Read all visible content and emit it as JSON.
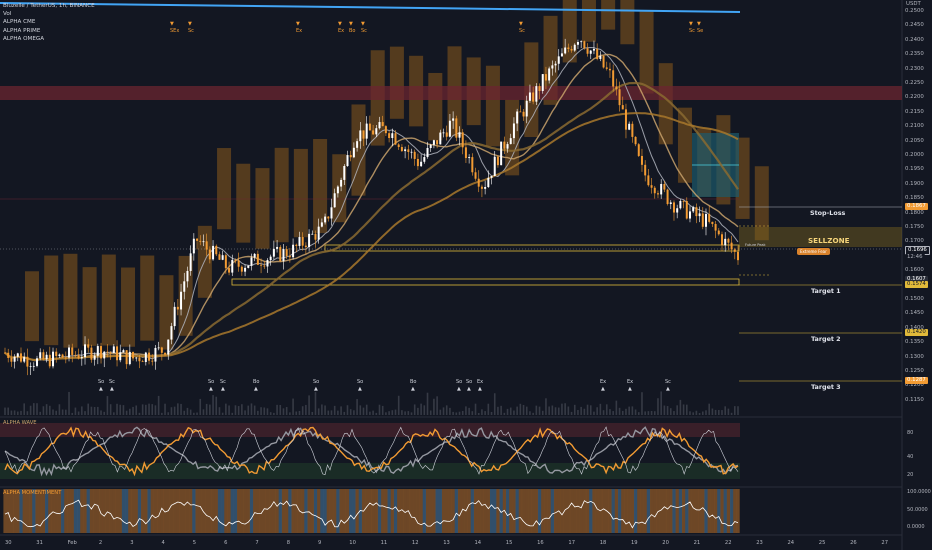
{
  "header": {
    "symbol_line": "Bluzelle / TetherUS, 1h, BINANCE",
    "vol": "Vol",
    "indicators": [
      "ALPHA CME",
      "ALPHA PRIME",
      "ALPHA OMEGA"
    ],
    "currency": "USDT"
  },
  "price_axis": [
    "0.2500",
    "0.2450",
    "0.2400",
    "0.2350",
    "0.2300",
    "0.2250",
    "0.2200",
    "0.2150",
    "0.2100",
    "0.2050",
    "0.2000",
    "0.1950",
    "0.1900",
    "0.1850",
    "0.1800",
    "0.1750",
    "0.1700",
    "0.1650",
    "0.1600",
    "0.1550",
    "0.1500",
    "0.1450",
    "0.1400",
    "0.1350",
    "0.1300",
    "0.1250",
    "0.1200",
    "0.1150"
  ],
  "price_tags": {
    "stop": "0.1867",
    "current": "0.1696",
    "countdown": "12:46",
    "last": "0.1607",
    "target1": "0.1574",
    "target2": "0.1420",
    "target3": "0.1287"
  },
  "zones": {
    "stop_loss": "Stop-Loss",
    "sellzone": "SELLZONE",
    "extreme": "Extreme Fear",
    "target1": "Target 1",
    "target2": "Target 2",
    "target3": "Target 3",
    "future_peak": "Future Peak"
  },
  "top_signals": [
    "SEx",
    "Sc",
    "Ex",
    "Ex",
    "Bo",
    "Sc",
    "Sc",
    "Sc",
    "Se"
  ],
  "bottom_signals": [
    "So",
    "Sc",
    "So",
    "Sc",
    "Bo",
    "So",
    "So",
    "Bo",
    "So",
    "So",
    "Ex",
    "Ex",
    "Ex",
    "Sc"
  ],
  "panes": {
    "wave": "ALPHA WAVE",
    "wave_axis": [
      "80",
      "40",
      "20"
    ],
    "momentum": "ALPHA MOMENTIMENT",
    "mom_axis": [
      "100.0000",
      "50.0000",
      "0.0000"
    ]
  },
  "time_axis": [
    "30",
    "31",
    "Feb",
    "2",
    "3",
    "4",
    "5",
    "6",
    "7",
    "8",
    "9",
    "10",
    "11",
    "12",
    "13",
    "14",
    "15",
    "16",
    "17",
    "18",
    "19",
    "20",
    "21",
    "22",
    "23",
    "24",
    "25",
    "26",
    "27"
  ],
  "colors": {
    "bg": "#131722",
    "accent": "#f29b33",
    "cloud": "#8a5a1c",
    "red_band": "#6b2630",
    "blue_line": "#42a5f5",
    "yellow_box": "#e0b93a"
  },
  "chart_data": {
    "type": "line",
    "title": "",
    "xlabel": "",
    "ylabel": "",
    "ylim": [
      0.115,
      0.25
    ],
    "x": [
      "30",
      "31",
      "Feb",
      "2",
      "3",
      "4",
      "5",
      "6",
      "7",
      "8",
      "9",
      "10",
      "11",
      "12",
      "13",
      "14",
      "15",
      "16",
      "17",
      "18",
      "19",
      "20",
      "21",
      "22"
    ],
    "series": [
      {
        "name": "",
        "values": [
          0.133,
          0.13,
          0.132,
          0.134,
          0.131,
          0.134,
          0.172,
          0.162,
          0.165,
          0.168,
          0.176,
          0.208,
          0.21,
          0.198,
          0.212,
          0.19,
          0.212,
          0.228,
          0.242,
          0.228,
          0.195,
          0.184,
          0.178,
          0.166
        ]
      }
    ]
  }
}
